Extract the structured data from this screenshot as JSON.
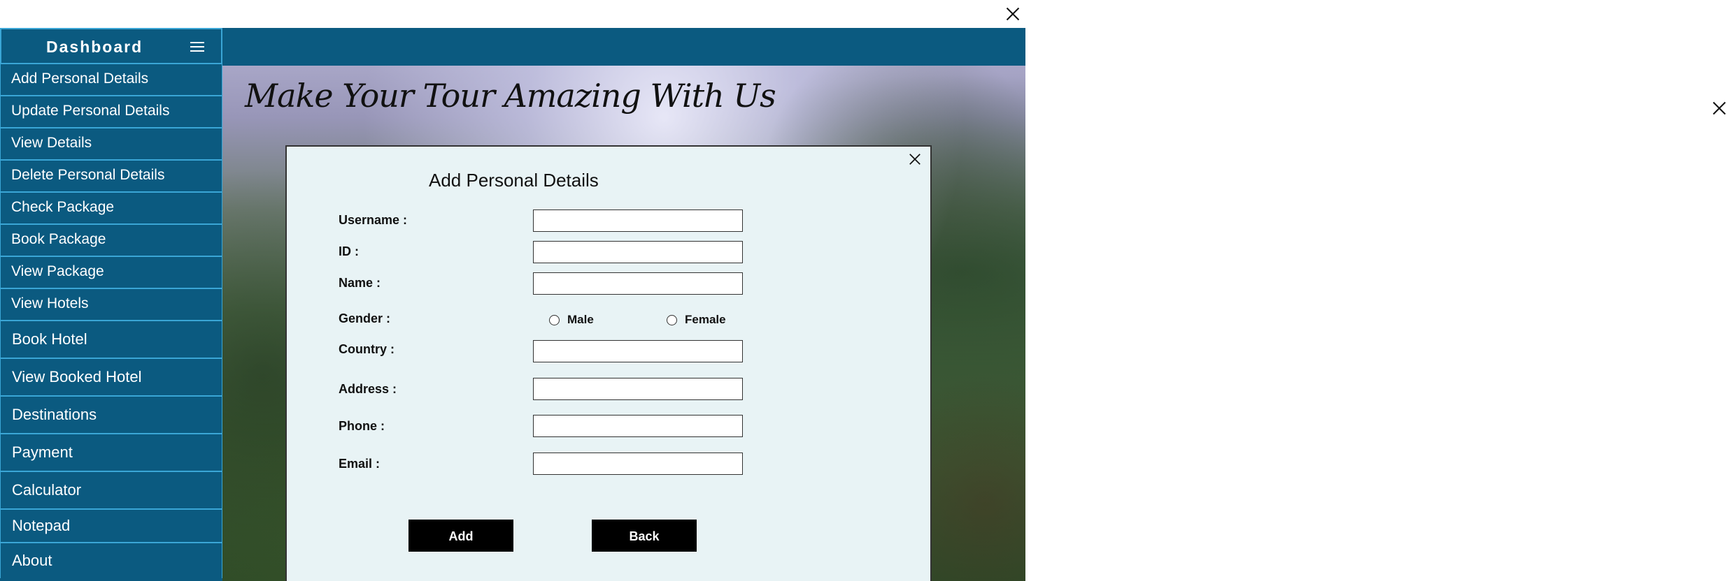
{
  "sidebar": {
    "title": "Dashboard",
    "items": [
      {
        "label": "Add Personal Details"
      },
      {
        "label": "Update Personal Details"
      },
      {
        "label": "View Details"
      },
      {
        "label": "Delete Personal Details"
      },
      {
        "label": "Check Package"
      },
      {
        "label": "Book Package"
      },
      {
        "label": "View Package"
      },
      {
        "label": "View Hotels"
      },
      {
        "label": "Book Hotel"
      },
      {
        "label": "View Booked Hotel"
      },
      {
        "label": "Destinations"
      },
      {
        "label": "Payment"
      },
      {
        "label": "Calculator"
      },
      {
        "label": "Notepad"
      },
      {
        "label": "About"
      }
    ]
  },
  "banner": {
    "tagline": "Make Your Tour Amazing With Us"
  },
  "dialog": {
    "title": "Add Personal Details",
    "fields": {
      "username": {
        "label": "Username :",
        "value": ""
      },
      "id": {
        "label": "ID :",
        "value": ""
      },
      "name": {
        "label": "Name :",
        "value": ""
      },
      "gender": {
        "label": "Gender :",
        "options": [
          "Male",
          "Female"
        ],
        "selected": null
      },
      "country": {
        "label": "Country :",
        "value": ""
      },
      "address": {
        "label": "Address :",
        "value": ""
      },
      "phone": {
        "label": "Phone :",
        "value": ""
      },
      "email": {
        "label": "Email :",
        "value": ""
      }
    },
    "buttons": {
      "add": "Add",
      "back": "Back"
    }
  },
  "icons": {
    "window_close": "close-icon",
    "dialog_close": "close-icon",
    "sidebar_toggle": "hamburger-menu-icon"
  },
  "colors": {
    "sidebar_bg": "#0b5a80",
    "sidebar_border": "#3aa6d6",
    "dialog_bg": "#e8f3f5",
    "button_bg": "#000000",
    "button_text": "#ffffff"
  }
}
